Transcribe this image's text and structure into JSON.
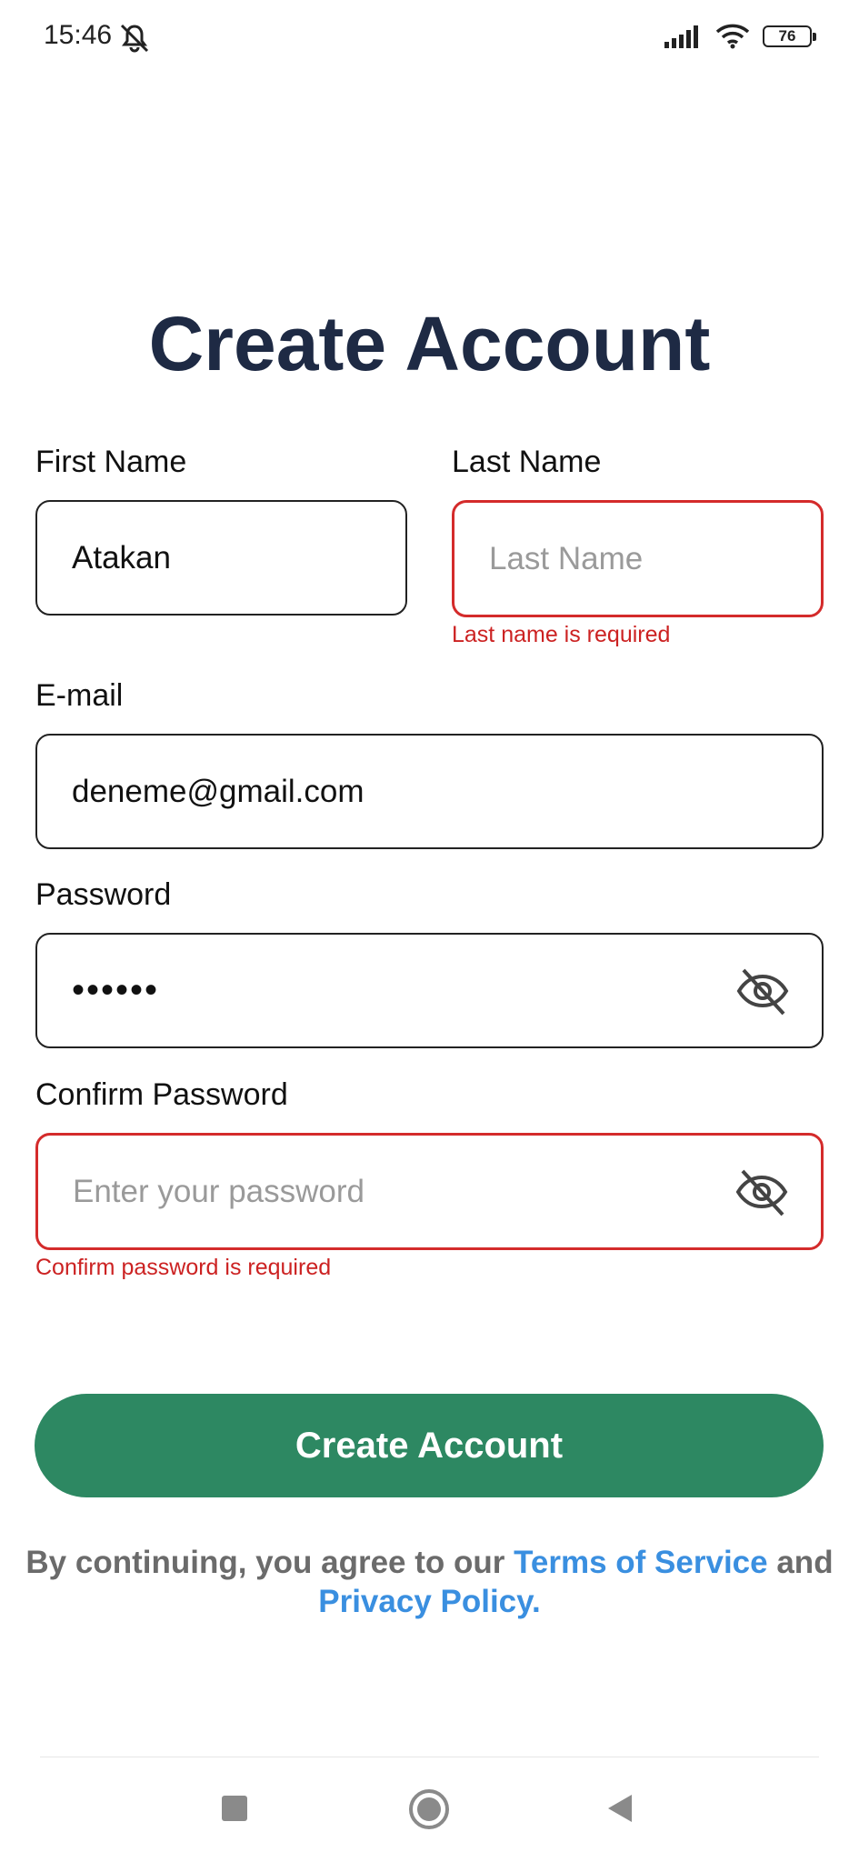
{
  "status_bar": {
    "time": "15:46",
    "battery": "76"
  },
  "title": "Create Account",
  "form": {
    "first_name": {
      "label": "First Name",
      "value": "Atakan"
    },
    "last_name": {
      "label": "Last Name",
      "placeholder": "Last Name",
      "error": "Last name is required"
    },
    "email": {
      "label": "E-mail",
      "value": "deneme@gmail.com"
    },
    "password": {
      "label": "Password",
      "value": "••••••"
    },
    "confirm_password": {
      "label": "Confirm Password",
      "placeholder": "Enter your password",
      "error": "Confirm password is required"
    }
  },
  "submit_label": "Create Account",
  "legal": {
    "prefix": "By continuing, you agree to our",
    "terms": "Terms of Service",
    "and": "and",
    "privacy": "Privacy Policy."
  },
  "colors": {
    "title": "#1e2a44",
    "button": "#2d8862",
    "error": "#d42b2b",
    "link": "#3a8fe0"
  },
  "icons": [
    "mute-icon",
    "signal-icon",
    "wifi-icon",
    "battery-icon",
    "eye-off-icon",
    "home-icon",
    "back-icon",
    "recents-icon"
  ]
}
